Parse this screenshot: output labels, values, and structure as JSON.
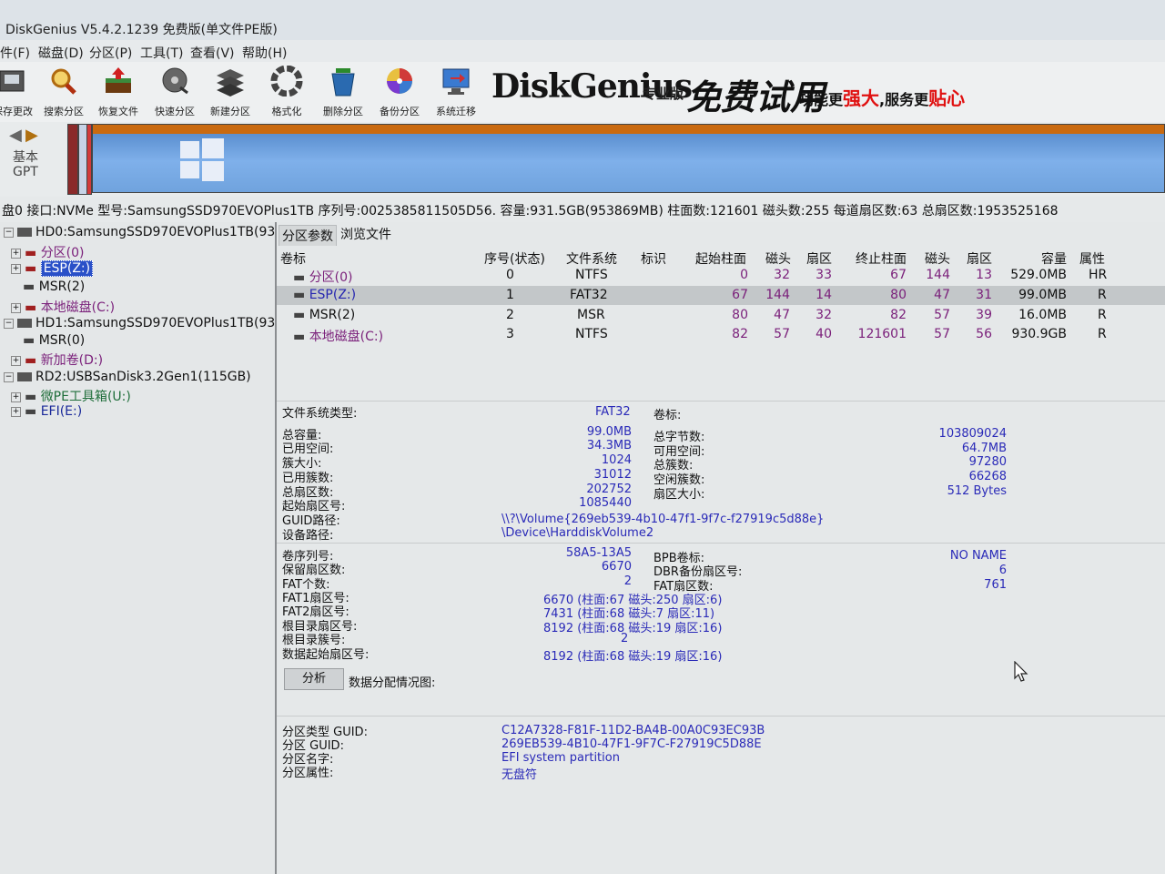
{
  "window": {
    "title": "DiskGenius V5.4.2.1239 免费版(单文件PE版)"
  },
  "menu": [
    "件(F)",
    "磁盘(D)",
    "分区(P)",
    "工具(T)",
    "查看(V)",
    "帮助(H)"
  ],
  "toolbar": {
    "buttons": [
      {
        "label": "保存更改",
        "icon": "save-icon"
      },
      {
        "label": "搜索分区",
        "icon": "search-icon"
      },
      {
        "label": "恢复文件",
        "icon": "recover-icon"
      },
      {
        "label": "快速分区",
        "icon": "quick-partition-icon"
      },
      {
        "label": "新建分区",
        "icon": "new-partition-icon"
      },
      {
        "label": "格式化",
        "icon": "format-icon"
      },
      {
        "label": "删除分区",
        "icon": "delete-icon"
      },
      {
        "label": "备份分区",
        "icon": "backup-icon"
      },
      {
        "label": "系统迁移",
        "icon": "migrate-icon"
      }
    ],
    "banner": {
      "brand": "DiskGenius",
      "edition": "专业版",
      "trial": "免费试用",
      "slogan_a": "功能更",
      "slogan_b": "强大",
      "slogan_c": ",服务更",
      "slogan_d": "贴心"
    }
  },
  "diskmap": {
    "nav_label_1": "基本",
    "nav_label_2": "GPT"
  },
  "disk_info": "盘0 接口:NVMe  型号:SamsungSSD970EVOPlus1TB  序列号:0025385811505D56.  容量:931.5GB(953869MB)  柱面数:121601  磁头数:255  每道扇区数:63  总扇区数:1953525168",
  "tree": [
    {
      "label": "HD0:SamsungSSD970EVOPlus1TB(93",
      "level": 0,
      "type": "disk"
    },
    {
      "label": "分区(0)",
      "level": 1,
      "color": "#7a1f7a",
      "type": "part"
    },
    {
      "label": "ESP(Z:)",
      "level": 1,
      "color": "#ffffff",
      "selected": true,
      "type": "part"
    },
    {
      "label": "MSR(2)",
      "level": 1,
      "color": "#111111",
      "type": "part"
    },
    {
      "label": "本地磁盘(C:)",
      "level": 1,
      "color": "#7a1f7a",
      "type": "part"
    },
    {
      "label": "HD1:SamsungSSD970EVOPlus1TB(93",
      "level": 0,
      "type": "disk"
    },
    {
      "label": "MSR(0)",
      "level": 1,
      "color": "#111111",
      "type": "part"
    },
    {
      "label": "新加卷(D:)",
      "level": 1,
      "color": "#7a1f7a",
      "type": "part"
    },
    {
      "label": "RD2:USBSanDisk3.2Gen1(115GB)",
      "level": 0,
      "type": "disk"
    },
    {
      "label": "微PE工具箱(U:)",
      "level": 1,
      "color": "#1f6e3a",
      "type": "part"
    },
    {
      "label": "EFI(E:)",
      "level": 1,
      "color": "#1a2a9a",
      "type": "part"
    }
  ],
  "tabs": [
    "分区参数",
    "浏览文件"
  ],
  "table": {
    "headers": [
      "卷标",
      "序号(状态)",
      "文件系统",
      "标识",
      "起始柱面",
      "磁头",
      "扇区",
      "终止柱面",
      "磁头",
      "扇区",
      "容量",
      "属性"
    ],
    "rows": [
      {
        "name": "分区(0)",
        "idx": "0",
        "fs": "NTFS",
        "flag": "",
        "sc": "0",
        "sh": "32",
        "ss": "33",
        "ec": "67",
        "eh": "144",
        "es": "13",
        "size": "529.0MB",
        "attr": "HR"
      },
      {
        "name": "ESP(Z:)",
        "idx": "1",
        "fs": "FAT32",
        "flag": "",
        "sc": "67",
        "sh": "144",
        "ss": "14",
        "ec": "80",
        "eh": "47",
        "es": "31",
        "size": "99.0MB",
        "attr": "R"
      },
      {
        "name": "MSR(2)",
        "idx": "2",
        "fs": "MSR",
        "flag": "",
        "sc": "80",
        "sh": "47",
        "ss": "32",
        "ec": "82",
        "eh": "57",
        "es": "39",
        "size": "16.0MB",
        "attr": "R"
      },
      {
        "name": "本地磁盘(C:)",
        "idx": "3",
        "fs": "NTFS",
        "flag": "",
        "sc": "82",
        "sh": "57",
        "ss": "40",
        "ec": "121601",
        "eh": "57",
        "es": "56",
        "size": "930.9GB",
        "attr": "R"
      }
    ]
  },
  "details": {
    "fs_type_label": "文件系统类型:",
    "fs_type": "FAT32",
    "volume_label_label": "卷标:",
    "left": [
      {
        "label": "总容量:",
        "value": "99.0MB"
      },
      {
        "label": "已用空间:",
        "value": "34.3MB"
      },
      {
        "label": "簇大小:",
        "value": "1024"
      },
      {
        "label": "已用簇数:",
        "value": "31012"
      },
      {
        "label": "总扇区数:",
        "value": "202752"
      },
      {
        "label": "起始扇区号:",
        "value": "1085440"
      }
    ],
    "right": [
      {
        "label": "总字节数:",
        "value": "103809024"
      },
      {
        "label": "可用空间:",
        "value": "64.7MB"
      },
      {
        "label": "总簇数:",
        "value": "97280"
      },
      {
        "label": "空闲簇数:",
        "value": "66268"
      },
      {
        "label": "扇区大小:",
        "value": "512 Bytes"
      }
    ],
    "guid_path_label": "GUID路径:",
    "guid_path": "\\\\?\\Volume{269eb539-4b10-47f1-9f7c-f27919c5d88e}",
    "device_path_label": "设备路径:",
    "device_path": "\\Device\\HarddiskVolume2",
    "left2": [
      {
        "label": "卷序列号:",
        "value": "58A5-13A5"
      },
      {
        "label": "保留扇区数:",
        "value": "6670"
      },
      {
        "label": "FAT个数:",
        "value": "2"
      }
    ],
    "right2": [
      {
        "label": "BPB卷标:",
        "value": "NO NAME"
      },
      {
        "label": "DBR备份扇区号:",
        "value": "6"
      },
      {
        "label": "FAT扇区数:",
        "value": "761"
      }
    ],
    "wide": [
      {
        "label": "FAT1扇区号:",
        "value": "6670 (柱面:67 磁头:250 扇区:6)"
      },
      {
        "label": "FAT2扇区号:",
        "value": "7431 (柱面:68 磁头:7 扇区:11)"
      },
      {
        "label": "根目录扇区号:",
        "value": "8192 (柱面:68 磁头:19 扇区:16)"
      },
      {
        "label": "根目录簇号:",
        "value": "2"
      },
      {
        "label": "数据起始扇区号:",
        "value": "8192 (柱面:68 磁头:19 扇区:16)"
      }
    ],
    "analyze_button": "分析",
    "alloc_label": "数据分配情况图:",
    "guid_block": [
      {
        "label": "分区类型 GUID:",
        "value": "C12A7328-F81F-11D2-BA4B-00A0C93EC93B"
      },
      {
        "label": "分区 GUID:",
        "value": "269EB539-4B10-47F1-9F7C-F27919C5D88E"
      },
      {
        "label": "分区名字:",
        "value": "EFI system partition"
      },
      {
        "label": "分区属性:",
        "value": "无盘符"
      }
    ]
  }
}
